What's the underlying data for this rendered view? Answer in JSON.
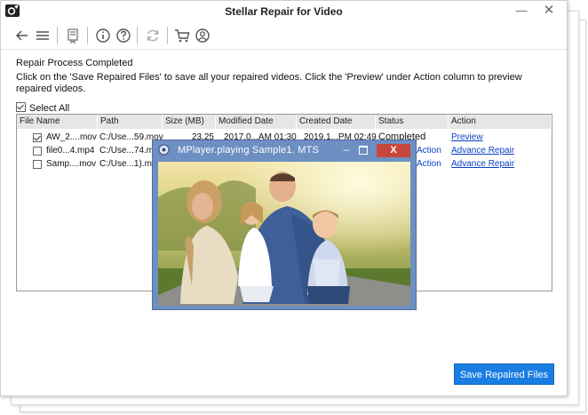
{
  "window": {
    "title": "Stellar Repair for Video",
    "minimize_glyph": "—",
    "close_glyph": "✕"
  },
  "toolbar": {
    "icons": [
      "back-arrow-icon",
      "menu-icon",
      "save-icon",
      "info-icon",
      "help-icon",
      "refresh-icon",
      "cart-icon",
      "user-icon"
    ]
  },
  "main": {
    "heading": "Repair Process Completed",
    "description": "Click on the 'Save Repaired Files' to save all your repaired videos. Click the 'Preview' under Action column to preview repaired videos.",
    "select_all_label": "Select All",
    "select_all_checked": true
  },
  "table": {
    "columns": [
      "File Name",
      "Path",
      "Size (MB)",
      "Modified Date",
      "Created Date",
      "Status",
      "Action"
    ],
    "rows": [
      {
        "checked": true,
        "file_name": "AW_2....mov",
        "path": "C:/Use...59.mov",
        "size": "23.25",
        "modified": "2017.0...AM 01:30",
        "created": "2019.1...PM 02:49",
        "status": "Completed",
        "action_prefix": "",
        "action": "Preview"
      },
      {
        "checked": false,
        "file_name": "file0...4.mp4",
        "path": "C:/Use...74.m",
        "size": "",
        "modified": "",
        "created": "",
        "status": "",
        "action_prefix": "Action",
        "action": "Advance Repair"
      },
      {
        "checked": false,
        "file_name": "Samp....mov",
        "path": "C:/Use...1).m",
        "size": "",
        "modified": "",
        "created": "",
        "status": "",
        "action_prefix": "Action",
        "action": "Advance Repair"
      }
    ]
  },
  "footer": {
    "save_button": "Save Repaired Files"
  },
  "player": {
    "title": "MPlayer.playing Sample1. MTS",
    "close_label": "X",
    "minimize_glyph": "–"
  },
  "colors": {
    "accent": "#1a7de2",
    "link": "#0b3fc6",
    "player_frame": "#6d8fc2",
    "player_close": "#c9463d"
  }
}
